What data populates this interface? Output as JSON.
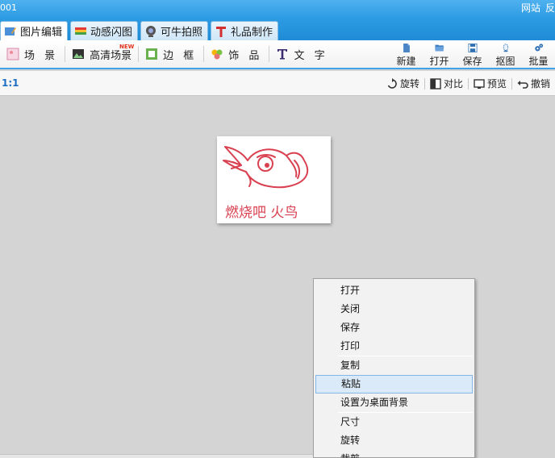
{
  "app": {
    "title_fragment": "001",
    "top_links": [
      "网站",
      "反"
    ]
  },
  "tabs": [
    {
      "label": "图片编辑",
      "icon": "picture-edit-icon"
    },
    {
      "label": "动感闪图",
      "icon": "film-strip-icon"
    },
    {
      "label": "可牛拍照",
      "icon": "webcam-icon"
    },
    {
      "label": "礼品制作",
      "icon": "gift-icon"
    }
  ],
  "toolbar": {
    "tools": [
      {
        "label": "场 景",
        "icon": "scene-icon"
      },
      {
        "label": "高清场景",
        "icon": "hd-scene-icon",
        "badge": "NEW"
      },
      {
        "label": "边 框",
        "icon": "frame-icon"
      },
      {
        "label": "饰 品",
        "icon": "decoration-icon"
      },
      {
        "label": "文 字",
        "icon": "text-icon"
      }
    ],
    "actions": [
      {
        "label": "新建",
        "icon": "new-file-icon"
      },
      {
        "label": "打开",
        "icon": "open-folder-icon"
      },
      {
        "label": "保存",
        "icon": "save-disk-icon"
      },
      {
        "label": "抠图",
        "icon": "cutout-icon"
      },
      {
        "label": "批量",
        "icon": "batch-gear-icon"
      }
    ]
  },
  "subbar": {
    "ratio_label": "1:1",
    "tools": [
      {
        "label": "旋转",
        "icon": "rotate-icon"
      },
      {
        "label": "对比",
        "icon": "compare-icon"
      },
      {
        "label": "预览",
        "icon": "preview-icon"
      },
      {
        "label": "撤销",
        "icon": "undo-icon"
      }
    ]
  },
  "image": {
    "caption": "燃烧吧 火鸟"
  },
  "context_menu": {
    "groups": [
      [
        "打开",
        "关闭",
        "保存",
        "打印"
      ],
      [
        "复制",
        "粘贴",
        "设置为桌面背景"
      ],
      [
        "尺寸",
        "旋转",
        "裁剪"
      ]
    ],
    "highlighted": "粘贴"
  },
  "colors": {
    "title_blue": "#2d9be3",
    "accent_blue": "#3ea3e6",
    "ratio_blue": "#1d6fc2",
    "menu_highlight": "#dbeaf9",
    "doodle_red": "#d94050"
  }
}
